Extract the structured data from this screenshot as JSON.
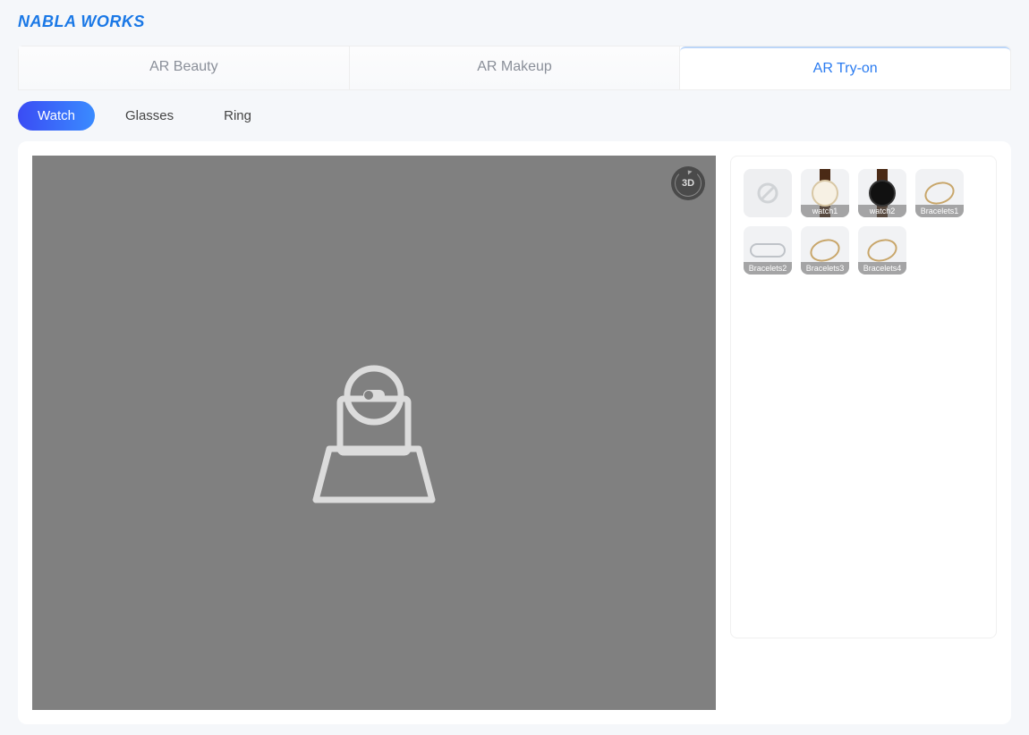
{
  "brand": "NABLA WORKS",
  "top_tabs": [
    {
      "id": "ar-beauty",
      "label": "AR Beauty",
      "active": false
    },
    {
      "id": "ar-makeup",
      "label": "AR Makeup",
      "active": false
    },
    {
      "id": "ar-tryon",
      "label": "AR Try-on",
      "active": true
    }
  ],
  "category_pills": [
    {
      "id": "watch",
      "label": "Watch",
      "active": true
    },
    {
      "id": "glasses",
      "label": "Glasses",
      "active": false
    },
    {
      "id": "ring",
      "label": "Ring",
      "active": false
    }
  ],
  "view3d_label": "3D",
  "thumbnails": [
    {
      "id": "none",
      "type": "none",
      "label": ""
    },
    {
      "id": "watch1",
      "type": "watch-light",
      "label": "watch1"
    },
    {
      "id": "watch2",
      "type": "watch-dark",
      "label": "watch2"
    },
    {
      "id": "bracelets1",
      "type": "bracelet-gold",
      "label": "Bracelets1"
    },
    {
      "id": "bracelets2",
      "type": "bracelet-silver",
      "label": "Bracelets2"
    },
    {
      "id": "bracelets3",
      "type": "bracelet-gold",
      "label": "Bracelets3"
    },
    {
      "id": "bracelets4",
      "type": "bracelet-gold",
      "label": "Bracelets4"
    }
  ]
}
